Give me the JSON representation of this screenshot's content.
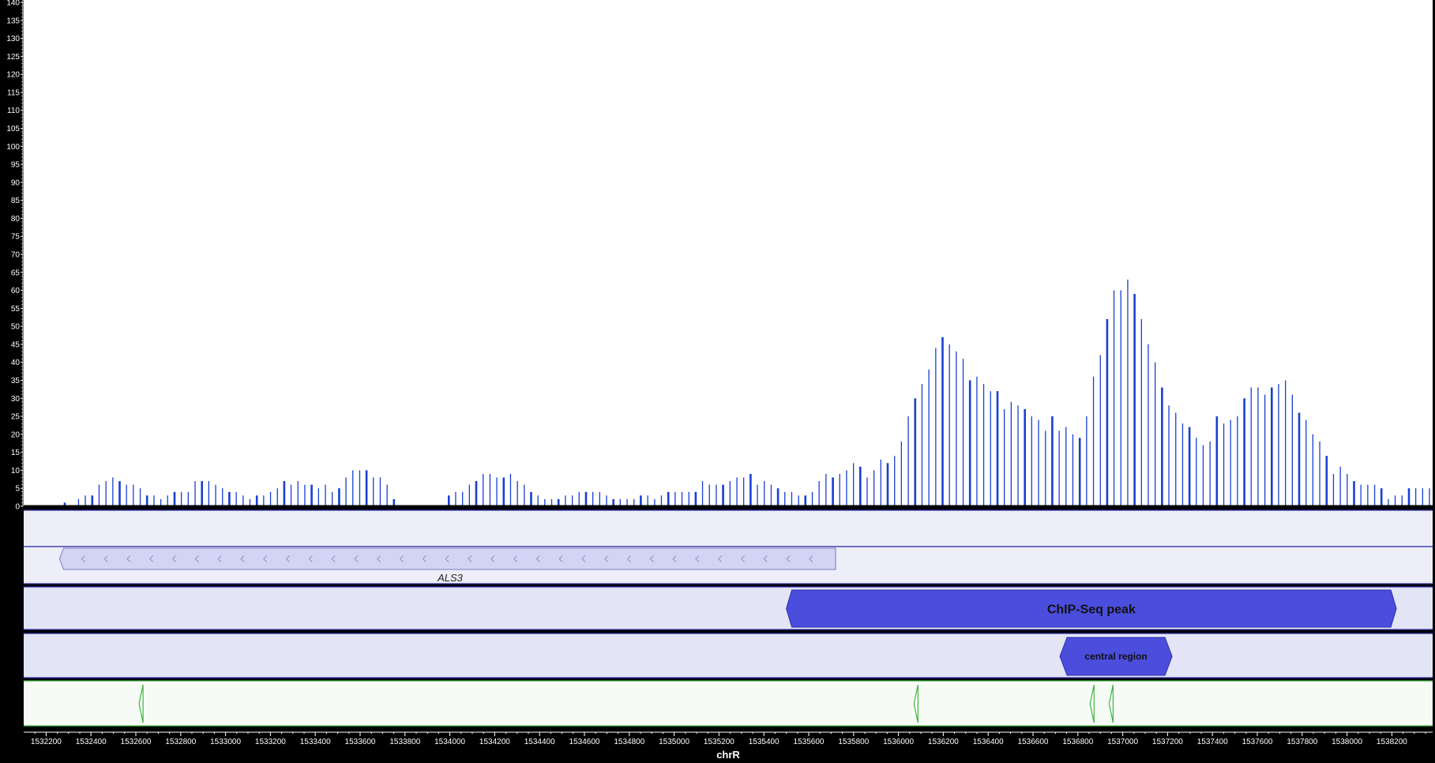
{
  "chart_data": {
    "type": "bar",
    "chromosome": "chrR",
    "ylim": [
      0,
      140
    ],
    "ytick_step": 5,
    "xlim": [
      1532100,
      1538400
    ],
    "xticks": [
      1532200,
      1532400,
      1532600,
      1532800,
      1533000,
      1533200,
      1533400,
      1533600,
      1533800,
      1534000,
      1534200,
      1534400,
      1534600,
      1534800,
      1535000,
      1535200,
      1535400,
      1535600,
      1535800,
      1536000,
      1536200,
      1536400,
      1536600,
      1536800,
      1537000,
      1537200,
      1537400,
      1537600,
      1537800,
      1538000,
      1538200
    ],
    "coverage": [
      0,
      0,
      0,
      1,
      0,
      2,
      3,
      3,
      6,
      7,
      8,
      7,
      6,
      6,
      5,
      3,
      3,
      2,
      3,
      4,
      4,
      4,
      7,
      7,
      7,
      6,
      5,
      4,
      4,
      3,
      2,
      3,
      3,
      4,
      5,
      7,
      6,
      7,
      6,
      6,
      5,
      6,
      4,
      5,
      8,
      10,
      10,
      10,
      8,
      8,
      6,
      2,
      0,
      0,
      0,
      0,
      0,
      0,
      0,
      3,
      4,
      4,
      6,
      7,
      9,
      9,
      8,
      8,
      9,
      7,
      6,
      4,
      3,
      2,
      2,
      2,
      3,
      3,
      4,
      4,
      4,
      4,
      3,
      2,
      2,
      2,
      2,
      3,
      3,
      2,
      3,
      4,
      4,
      4,
      4,
      4,
      7,
      6,
      6,
      6,
      7,
      8,
      8,
      9,
      6,
      7,
      6,
      5,
      4,
      4,
      3,
      3,
      4,
      7,
      9,
      8,
      9,
      10,
      12,
      11,
      8,
      10,
      13,
      12,
      14,
      18,
      25,
      30,
      34,
      38,
      44,
      47,
      45,
      43,
      41,
      35,
      36,
      34,
      32,
      32,
      27,
      29,
      28,
      27,
      25,
      24,
      21,
      25,
      21,
      22,
      20,
      19,
      25,
      36,
      42,
      52,
      60,
      60,
      63,
      59,
      52,
      45,
      40,
      33,
      28,
      26,
      23,
      22,
      19,
      17,
      18,
      25,
      23,
      24,
      25,
      30,
      33,
      33,
      31,
      33,
      34,
      35,
      31,
      26,
      24,
      20,
      18,
      14,
      9,
      11,
      9,
      7,
      6,
      6,
      6,
      5,
      2,
      3,
      3,
      5,
      5,
      5,
      5
    ],
    "tracks": [
      {
        "features": []
      },
      {
        "features": [
          {
            "label": "ALS3",
            "start": 1532260,
            "end": 1535720,
            "strand": "-"
          }
        ]
      },
      {
        "features": [
          {
            "label": "ChIP-Seq peak",
            "start": 1535500,
            "end": 1538220,
            "strand": "."
          }
        ]
      },
      {
        "features": [
          {
            "label": "central region",
            "start": 1536720,
            "end": 1537220,
            "strand": "."
          }
        ]
      },
      {
        "motifs": [
          1532625,
          1536080,
          1536865,
          1536950
        ]
      }
    ]
  },
  "colors": {
    "background": "#000000",
    "plot_area": "#ffffff",
    "coverage_bar": "#1a3fd1",
    "empty_track": "#eeeef9",
    "gene_fill": "#d3d4f3",
    "gene_border": "#7a7bc2",
    "peak_fill": "#4b4ddc",
    "peak_track": "#e4e4f7",
    "track_line": "#2f31a3",
    "motif_track": "#f6fbf6",
    "motif_color": "#3fb33f",
    "axis_text": "#ffffff"
  }
}
